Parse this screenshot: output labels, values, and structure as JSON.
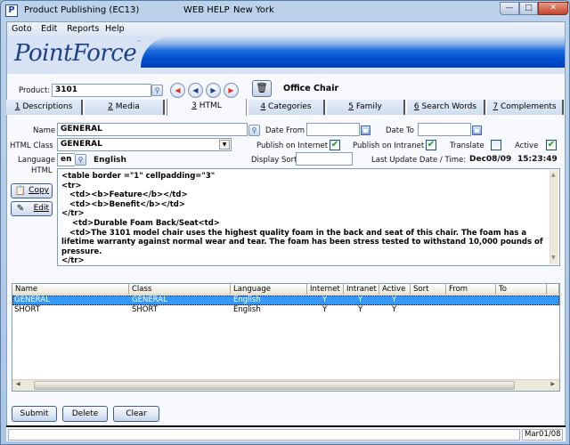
{
  "window": {
    "app_icon_letter": "P",
    "title": "Product Publishing (EC13)",
    "help": "WEB HELP",
    "location": "New York",
    "minimize": "—",
    "maximize": "□",
    "close": "✕"
  },
  "menu": [
    "Goto",
    "Edit",
    "Reports",
    "Help"
  ],
  "brand": {
    "name": "PointForce",
    "tm": "™"
  },
  "product": {
    "label": "Product:",
    "value": "3101",
    "description": "Office Chair",
    "nav": [
      "first",
      "previous",
      "next",
      "last"
    ]
  },
  "tabs": [
    {
      "num": "1",
      "label": " Descriptions"
    },
    {
      "num": "2",
      "label": " Media"
    },
    {
      "num": "3",
      "label": " HTML"
    },
    {
      "num": "4",
      "label": " Categories"
    },
    {
      "num": "5",
      "label": "  Family"
    },
    {
      "num": "6",
      "label": " Search Words"
    },
    {
      "num": "7",
      "label": " Complements"
    }
  ],
  "active_tab": "3 HTML",
  "form": {
    "name_label": "Name",
    "name_value": "GENERAL",
    "class_label": "HTML Class",
    "class_value": "GENERAL",
    "language_label": "Language",
    "language_code": "en",
    "language_name": "English",
    "html_label": "HTML",
    "date_from_label": "Date From",
    "date_from_value": "",
    "date_to_label": "Date To",
    "date_to_value": "",
    "publish_internet_label": "Publish on Internet",
    "publish_internet": true,
    "publish_intranet_label": "Publish on Intranet",
    "publish_intranet": true,
    "translate_label": "Translate",
    "translate": false,
    "active_label": "Active",
    "active": true,
    "display_sort_label": "Display Sort",
    "display_sort_value": "",
    "last_update_label": "Last Update Date / Time:",
    "last_update_date": "Dec08/09",
    "last_update_time": "15:23:49",
    "check_mark": "✔",
    "html_content": "<table border =\"1\" cellpadding=\"3\"\n<tr>\n   <td><b>Feature</b></td>\n   <td><b>Benefit</b></td>\n</tr>\n    <td>Durable Foam Back/Seat<td>\n   <td>The 3101 model chair uses the highest quality foam in the back and seat of this chair. The foam has a lifetime warranty against normal wear and tear. The foam has been stress tested to withstand 10,000 pounds of pressure.\n</tr>"
  },
  "side_buttons": {
    "copy": "Copy",
    "edit": "Edit"
  },
  "grid": {
    "columns": [
      "Name",
      "Class",
      "Language",
      "Internet",
      "Intranet",
      "Active",
      "Sort",
      "From",
      "To",
      ""
    ],
    "rows": [
      {
        "name": "GENERAL",
        "class": "GENERAL",
        "language": "English",
        "internet": "Y",
        "intranet": "Y",
        "active": "Y",
        "sort": "",
        "from": "",
        "to": "",
        "selected": true
      },
      {
        "name": "SHORT",
        "class": "SHORT",
        "language": "English",
        "internet": "Y",
        "intranet": "Y",
        "active": "Y",
        "sort": "",
        "from": "",
        "to": "",
        "selected": false
      }
    ]
  },
  "buttons": {
    "submit": "Submit",
    "delete": "Delete",
    "clear": "Clear"
  },
  "status": {
    "message": "",
    "date": "Mar01/08"
  }
}
